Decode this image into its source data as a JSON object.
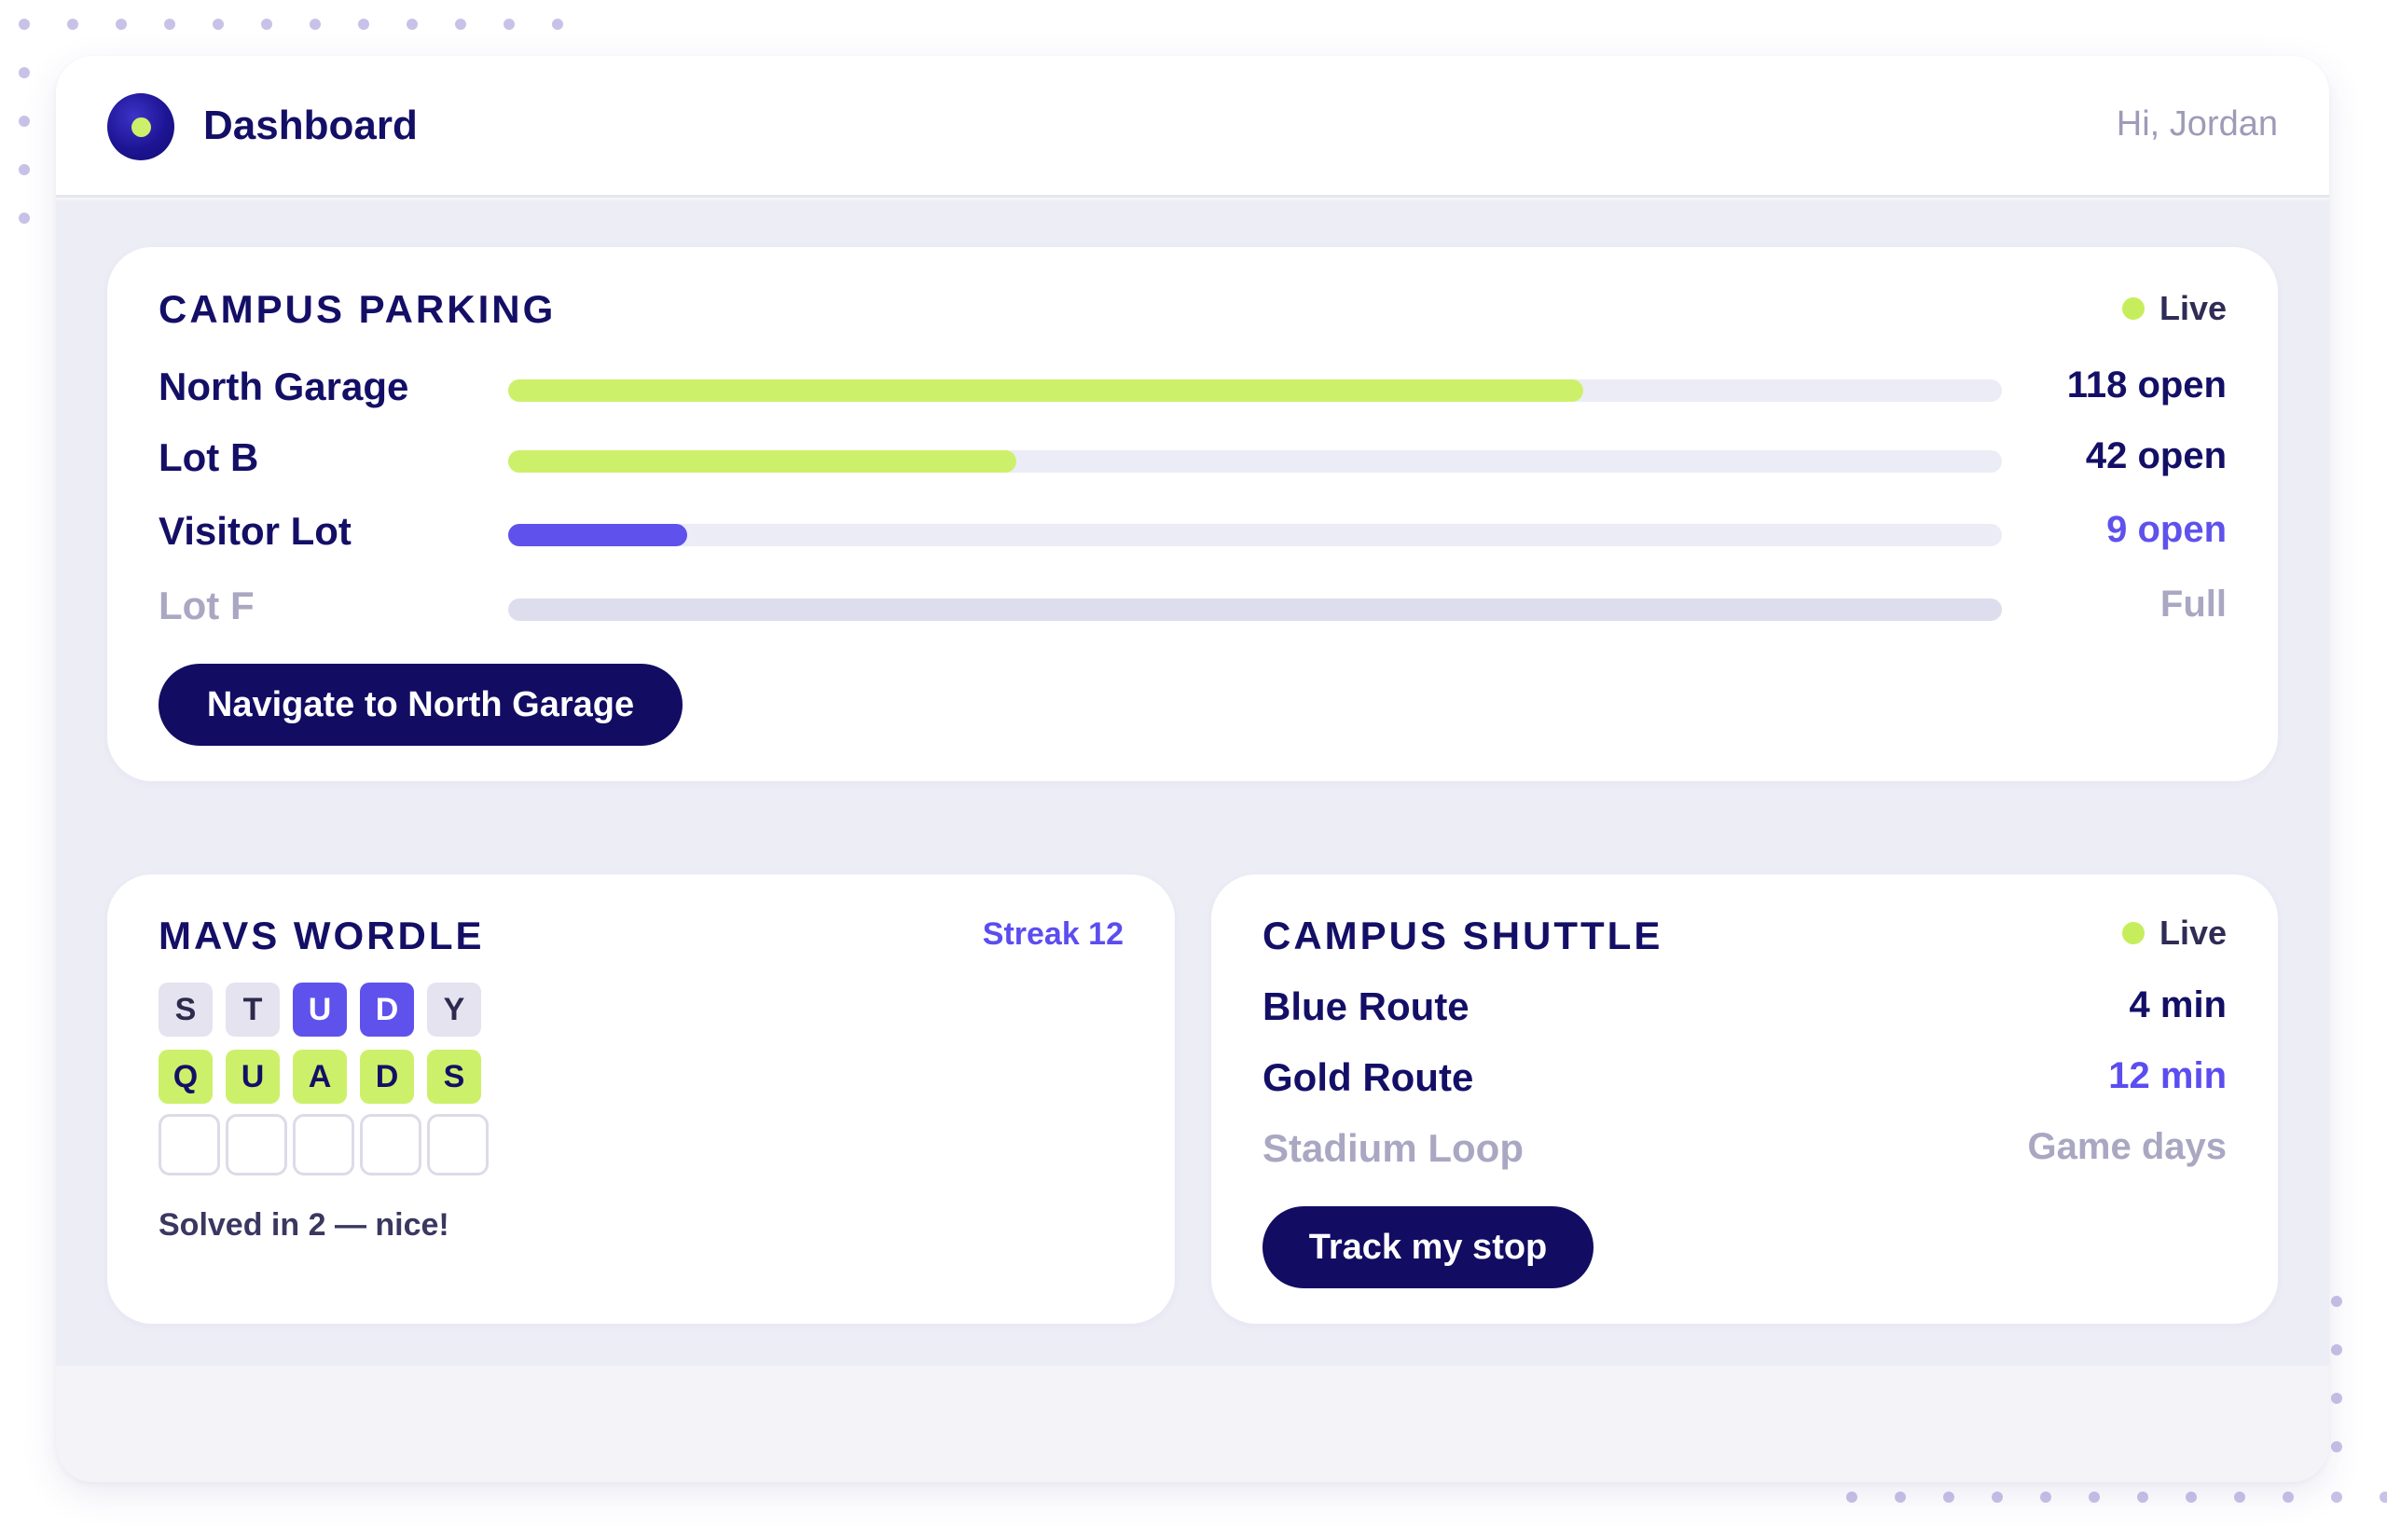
{
  "header": {
    "title": "Dashboard",
    "greeting": "Hi, Jordan"
  },
  "parking": {
    "title": "CAMPUS PARKING",
    "status": "Live",
    "lots": [
      {
        "name": "North Garage",
        "availability_label": "118 open",
        "fill_fraction": 0.72,
        "color": "#cdf06a"
      },
      {
        "name": "Lot B",
        "availability_label": "42 open",
        "fill_fraction": 0.34,
        "color": "#cdf06a"
      },
      {
        "name": "Visitor Lot",
        "availability_label": "9 open",
        "fill_fraction": 0.12,
        "color": "#5f52ec"
      },
      {
        "name": "Lot F",
        "availability_label": "Full",
        "fill_fraction": 0,
        "color": "#dedded"
      }
    ],
    "action_label": "Navigate to North Garage"
  },
  "wordle": {
    "title": "MAVS WORDLE",
    "streak_label": "Streak 12",
    "guesses": [
      {
        "letters": [
          "S",
          "T",
          "U",
          "D",
          "Y"
        ],
        "states": [
          "miss",
          "miss",
          "hit",
          "hit",
          "miss"
        ]
      },
      {
        "letters": [
          "Q",
          "U",
          "A",
          "D",
          "S"
        ],
        "states": [
          "win",
          "win",
          "win",
          "win",
          "win"
        ]
      }
    ],
    "empty_row_count": 5,
    "result_text": "Solved in 2 — nice!"
  },
  "shuttle": {
    "title": "CAMPUS SHUTTLE",
    "status": "Live",
    "routes": [
      {
        "name": "Blue Route",
        "eta": "4 min",
        "style": "normal"
      },
      {
        "name": "Gold Route",
        "eta": "12 min",
        "style": "accent"
      },
      {
        "name": "Stadium Loop",
        "eta": "Game days",
        "style": "muted"
      }
    ],
    "action_label": "Track my stop"
  },
  "colors": {
    "brand_navy": "#120c63",
    "accent_lime": "#cdf06a",
    "accent_violet": "#5f52ec",
    "muted_text": "#a9a7c2"
  },
  "icons": {
    "logo": "app-logo-icon",
    "live": "live-dot-icon"
  }
}
